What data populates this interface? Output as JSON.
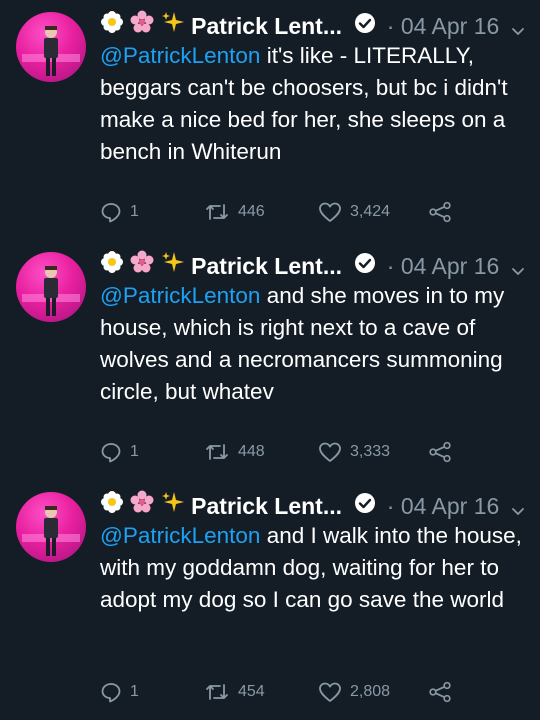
{
  "tweets": [
    {
      "author": "Patrick Lent...",
      "separator": "·",
      "date": "04 Apr 16",
      "mention": "@PatrickLenton",
      "text": " it's like - LITERALLY, beggars can't be choosers, but bc i didn't make a nice bed for her, she sleeps on a bench in Whiterun",
      "replies": "1",
      "retweets": "446",
      "likes": "3,424"
    },
    {
      "author": "Patrick Lent...",
      "separator": "·",
      "date": "04 Apr 16",
      "mention": "@PatrickLenton",
      "text": " and she moves in to my house, which is right next to a cave of wolves and a necromancers summoning circle, but whatev",
      "replies": "1",
      "retweets": "448",
      "likes": "3,333"
    },
    {
      "author": "Patrick Lent...",
      "separator": "·",
      "date": "04 Apr 16",
      "mention": "@PatrickLenton",
      "text": " and I walk into the house, with my goddamn dog, waiting for her to adopt my dog so I can go save the world",
      "replies": "1",
      "retweets": "454",
      "likes": "2,808"
    }
  ],
  "icons": {
    "header_emoji": [
      "blossom-icon",
      "cherry-blossom-icon",
      "sparkles-icon"
    ],
    "verified": "verified-badge-icon",
    "menu": "chevron-down-icon",
    "actions": [
      "reply-icon",
      "retweet-icon",
      "like-icon",
      "share-icon"
    ]
  },
  "colors": {
    "background": "#141d26",
    "text": "#ffffff",
    "muted": "#8899a6",
    "link": "#1da1f2",
    "avatar": "#e8209f"
  }
}
